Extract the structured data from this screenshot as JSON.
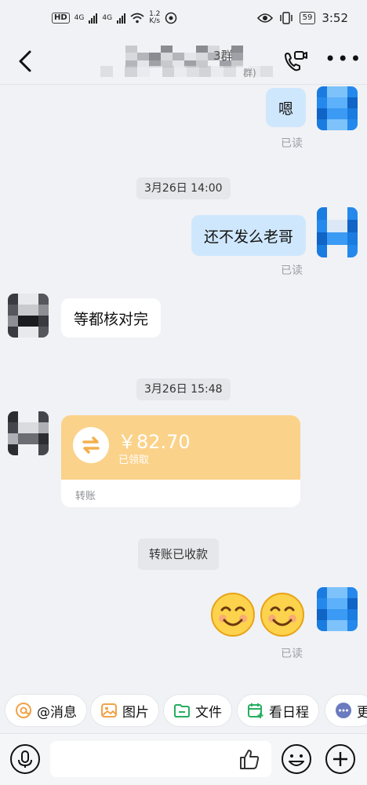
{
  "status_bar": {
    "hd_label": "HD",
    "net1": "4G",
    "net2": "4G",
    "speed_value": "1.2",
    "speed_unit": "K/s",
    "battery": "59",
    "time": "3:52"
  },
  "header": {
    "title_partial": "3群",
    "subtitle_partial": "群)"
  },
  "messages": [
    {
      "side": "me",
      "text": "嗯",
      "status": "已读"
    },
    {
      "type": "time",
      "text": "3月26日 14:00"
    },
    {
      "side": "me",
      "text": "还不发么老哥",
      "status": "已读"
    },
    {
      "side": "them",
      "text": "等都核对完"
    },
    {
      "type": "time",
      "text": "3月26日 15:48"
    },
    {
      "side": "them",
      "type": "transfer",
      "amount": "￥82.70",
      "status": "已领取",
      "label": "转账"
    },
    {
      "type": "system",
      "text": "转账已收款"
    },
    {
      "side": "me",
      "type": "emoji",
      "emoji": [
        "smile-emoji",
        "smile-emoji"
      ],
      "status": "已读"
    }
  ],
  "quick_actions": [
    {
      "label": "@消息",
      "icon": "at-icon"
    },
    {
      "label": "图片",
      "icon": "image-icon"
    },
    {
      "label": "文件",
      "icon": "folder-icon"
    },
    {
      "label": "看日程",
      "icon": "calendar-add-icon"
    },
    {
      "label": "更",
      "icon": "more-dots-icon"
    }
  ],
  "input": {
    "placeholder": ""
  },
  "colors": {
    "my_bubble": "#cfe7fd",
    "transfer_card": "#fbd28a",
    "accent_orange": "#f0a34a",
    "accent_green": "#27ae60",
    "avatar_blue": "#1a7be0"
  }
}
